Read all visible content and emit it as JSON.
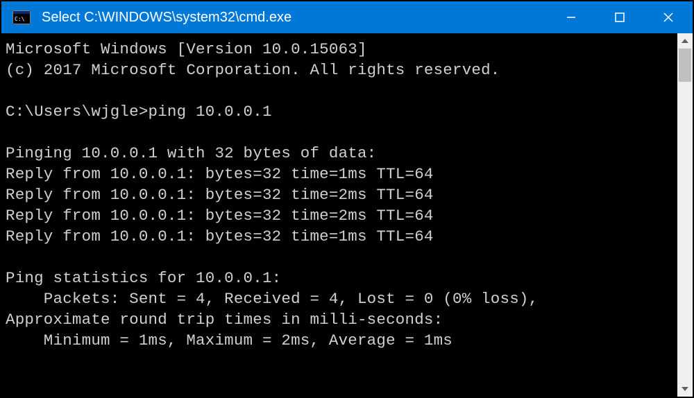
{
  "title": "Select C:\\WINDOWS\\system32\\cmd.exe",
  "lines": [
    "Microsoft Windows [Version 10.0.15063]",
    "(c) 2017 Microsoft Corporation. All rights reserved.",
    "",
    "C:\\Users\\wjgle>ping 10.0.0.1",
    "",
    "Pinging 10.0.0.1 with 32 bytes of data:",
    "Reply from 10.0.0.1: bytes=32 time=1ms TTL=64",
    "Reply from 10.0.0.1: bytes=32 time=2ms TTL=64",
    "Reply from 10.0.0.1: bytes=32 time=2ms TTL=64",
    "Reply from 10.0.0.1: bytes=32 time=1ms TTL=64",
    "",
    "Ping statistics for 10.0.0.1:",
    "    Packets: Sent = 4, Received = 4, Lost = 0 (0% loss),",
    "Approximate round trip times in milli-seconds:",
    "    Minimum = 1ms, Maximum = 2ms, Average = 1ms"
  ]
}
